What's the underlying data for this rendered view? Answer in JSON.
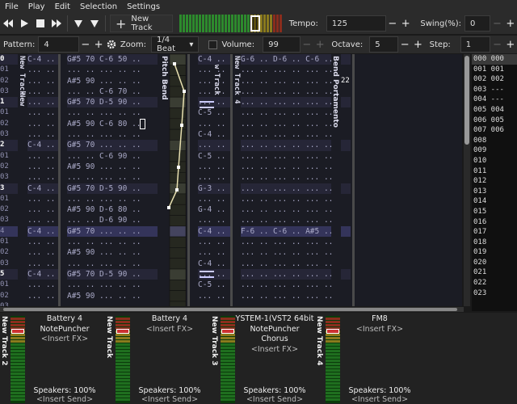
{
  "menu": [
    "File",
    "Play",
    "Edit",
    "Selection",
    "Settings"
  ],
  "toolbar": {
    "new_track": "New Track",
    "tempo_label": "Tempo:",
    "tempo_value": "125",
    "swing_label": "Swing(%):",
    "swing_value": "0",
    "minus": "−",
    "plus": "+"
  },
  "toolbar2": {
    "pattern_label": "Pattern:",
    "pattern_value": "4",
    "zoom_label": "Zoom:",
    "zoom_value": "1/4 Beat",
    "volume_label": "Volume:",
    "volume_value": "99",
    "octave_label": "Octave:",
    "octave_value": "5",
    "step_label": "Step:",
    "step_value": "1"
  },
  "tracks": {
    "t1": "New Track",
    "t2": "New Track 2",
    "pitch": "Pitch Bend",
    "t3": "New Track 3",
    "t4": "New Track 4",
    "bend": "Bend Portamento",
    "bend_value": "22"
  },
  "row_numbers": [
    "0",
    "01",
    "02",
    "03",
    "1",
    "01",
    "02",
    "03",
    "2",
    "01",
    "02",
    "03",
    "3",
    "01",
    "02",
    "03",
    "4",
    "01",
    "02",
    "03",
    "5",
    "01",
    "02",
    "03"
  ],
  "col_a": [
    "C-4 ..",
    "... ..",
    "... ..",
    "... ..",
    "... ..",
    "... ..",
    "... ..",
    "... ..",
    "C-4 ..",
    "... ..",
    "... ..",
    "... ..",
    "C-4 ..",
    "... ..",
    "... ..",
    "... ..",
    "C-4 ..",
    "... ..",
    "... ..",
    "... ..",
    "C-4 ..",
    "... ..",
    "... ..",
    "... .."
  ],
  "col_a2": [
    "",
    "",
    "",
    "",
    "C-4 ..",
    "",
    "",
    "",
    "",
    "",
    "",
    "",
    "",
    "",
    "",
    "",
    "",
    "",
    "",
    "",
    "",
    "",
    "",
    ""
  ],
  "col_b": [
    "G#5 70 C-6 50 ..",
    "... .. ... .. ..",
    "A#5 90 ... .. ..",
    "... .. C-6 70 ..",
    "G#5 70 D-5 90 ..",
    "... .. ... .. ..",
    "A#5 90 C-6 80 ..",
    "... .. ... .. ..",
    "G#5 70 ... .. ..",
    "... .. C-6 90 ..",
    "A#5 90 ... .. ..",
    "... .. ... .. ..",
    "G#5 70 D-5 90 ..",
    "... .. ... .. ..",
    "A#5 90 D-6 80 ..",
    "... .. D-6 90 ..",
    "G#5 70 ... .. ..",
    "... .. ... .. ..",
    "A#5 90 ... .. ..",
    "... .. ... .. ..",
    "G#5 70 D-5 90 ..",
    "... .. ... .. ..",
    "A#5 90 ... .. ..",
    "... .. ... .. .."
  ],
  "col_c": [
    "C-4 ..",
    "... ..",
    "... ..",
    "... ..",
    "... ..",
    "C-5 ..",
    "... ..",
    "C-4 ..",
    "... ..",
    "C-5 ..",
    "... ..",
    "... ..",
    "G-3 ..",
    "... ..",
    "G-4 ..",
    "... ..",
    "C-4 ..",
    "... ..",
    "... ..",
    "C-4 ..",
    "... ..",
    "C-5 ..",
    "... ..",
    "... .."
  ],
  "col_d": [
    "G-6 .. D-6 .. C-6 ..",
    "... .. ... .. ... ..",
    "... .. ... .. ... ..",
    "... .. ... .. ... ..",
    "... .. ... .. ... ..",
    "... .. ... .. ... ..",
    "... .. ... .. ... ..",
    "... .. ... .. ... ..",
    "... .. ... .. ... ..",
    "... .. ... .. ... ..",
    "... .. ... .. ... ..",
    "... .. ... .. ... ..",
    "... .. ... .. ... ..",
    "... .. ... .. ... ..",
    "... .. ... .. ... ..",
    "... .. ... .. ... ..",
    "F-6 .. C-6 .. A#5 ..",
    "... .. ... .. ... ..",
    "... .. ... .. ... ..",
    "... .. ... .. ... ..",
    "... .. ... .. ... ..",
    "... .. ... .. ... ..",
    "... .. ... .. ... ..",
    "... .. ... .. ... .."
  ],
  "sequence": [
    "000 000",
    "001 001",
    "002 002",
    "003 ---",
    "004 ---",
    "005 004",
    "006 005",
    "007 006",
    "008",
    "009",
    "010",
    "011",
    "012",
    "013",
    "014",
    "015",
    "016",
    "017",
    "018",
    "019",
    "020",
    "021",
    "022",
    "023"
  ],
  "mixer": {
    "strip1": {
      "name": "New Track 2",
      "lines": [
        "Battery 4",
        "NotePuncher",
        "<Insert FX>"
      ],
      "speakers": "Speakers: 100%",
      "send": "<Insert Send>"
    },
    "strip2": {
      "name": "New Track",
      "lines": [
        "Battery 4",
        "<Insert FX>"
      ],
      "speakers": "Speakers: 100%",
      "send": "<Insert Send>"
    },
    "strip3": {
      "name": "New Track 3",
      "lines": [
        "YSTEM-1(VST2 64bit",
        "NotePuncher",
        "Chorus",
        "<Insert FX>"
      ],
      "speakers": "Speakers: 100%",
      "send": "<Insert Send>"
    },
    "strip4": {
      "name": "New Track 4",
      "lines": [
        "FM8",
        "<Insert FX>"
      ],
      "speakers": "Speakers: 100%",
      "send": "<Insert Send>"
    }
  },
  "colors": {
    "accent": "#34345a",
    "pattern_bg": "#1b1c24",
    "vu_green": "#1f8a1f",
    "vu_red": "#c33"
  }
}
